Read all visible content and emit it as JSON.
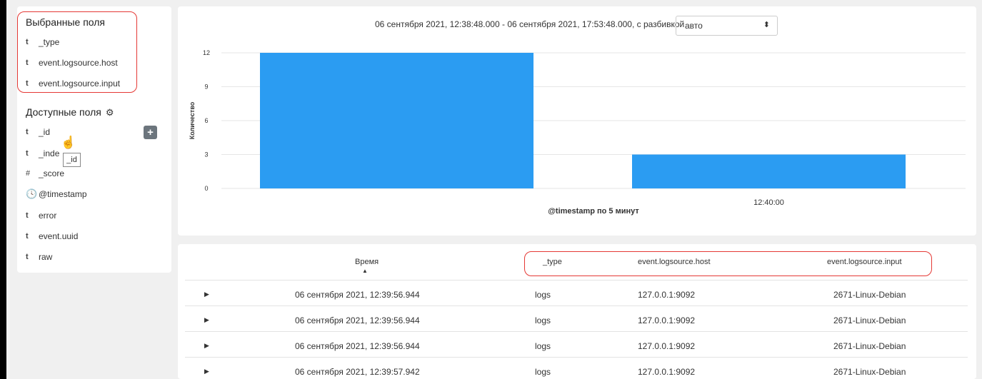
{
  "sidebar": {
    "selected_title": "Выбранные поля",
    "selected_fields": [
      {
        "type": "t",
        "name": "_type"
      },
      {
        "type": "t",
        "name": "event.logsource.host"
      },
      {
        "type": "t",
        "name": "event.logsource.input"
      }
    ],
    "available_title": "Доступные поля",
    "available_fields": [
      {
        "type": "t",
        "name": "_id"
      },
      {
        "type": "t",
        "name": "_inde"
      },
      {
        "type": "#",
        "name": "_score"
      },
      {
        "type": "clock",
        "name": "@timestamp"
      },
      {
        "type": "t",
        "name": "error"
      },
      {
        "type": "t",
        "name": "event.uuid"
      },
      {
        "type": "t",
        "name": "raw"
      }
    ],
    "add_button": "+",
    "tooltip": "_id"
  },
  "histogram": {
    "range_text": "06 сентября 2021, 12:38:48.000 - 06 сентября 2021, 17:53:48.000, с разбивкой",
    "interval_value": "авто"
  },
  "chart_data": {
    "type": "bar",
    "categories": [
      "",
      "12:40:00"
    ],
    "values": [
      12,
      3
    ],
    "xlabel": "@timestamp по 5 минут",
    "ylabel": "Количество",
    "yticks": [
      0,
      3,
      6,
      9,
      12
    ],
    "ylim": [
      0,
      12
    ],
    "grid": true,
    "bar_color": "#2b9cf2"
  },
  "table": {
    "headers": {
      "time": "Время",
      "type": "_type",
      "host": "event.logsource.host",
      "input": "event.logsource.input"
    },
    "rows": [
      {
        "time": "06 сентября 2021, 12:39:56.944",
        "type": "logs",
        "host": "127.0.0.1:9092",
        "input": "2671-Linux-Debian"
      },
      {
        "time": "06 сентября 2021, 12:39:56.944",
        "type": "logs",
        "host": "127.0.0.1:9092",
        "input": "2671-Linux-Debian"
      },
      {
        "time": "06 сентября 2021, 12:39:56.944",
        "type": "logs",
        "host": "127.0.0.1:9092",
        "input": "2671-Linux-Debian"
      },
      {
        "time": "06 сентября 2021, 12:39:57.942",
        "type": "logs",
        "host": "127.0.0.1:9092",
        "input": "2671-Linux-Debian"
      }
    ]
  }
}
